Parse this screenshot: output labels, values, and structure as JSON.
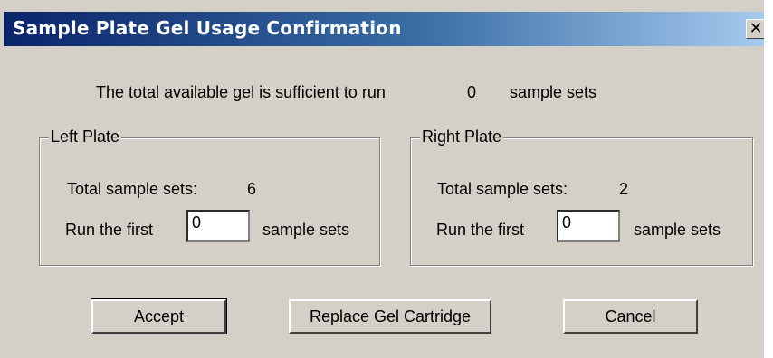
{
  "window": {
    "title": "Sample Plate Gel Usage Confirmation",
    "close_glyph": "✕"
  },
  "summary": {
    "prefix": "The total available gel is sufficient to run",
    "count": "0",
    "suffix": "sample sets"
  },
  "left_plate": {
    "legend": "Left Plate",
    "total_label": "Total sample sets:",
    "total_value": "6",
    "run_prefix": "Run the first",
    "run_value": "0",
    "run_suffix": "sample sets"
  },
  "right_plate": {
    "legend": "Right Plate",
    "total_label": "Total sample sets:",
    "total_value": "2",
    "run_prefix": "Run the first",
    "run_value": "0",
    "run_suffix": "sample sets"
  },
  "buttons": {
    "accept": "Accept",
    "replace": "Replace Gel Cartridge",
    "cancel": "Cancel"
  }
}
